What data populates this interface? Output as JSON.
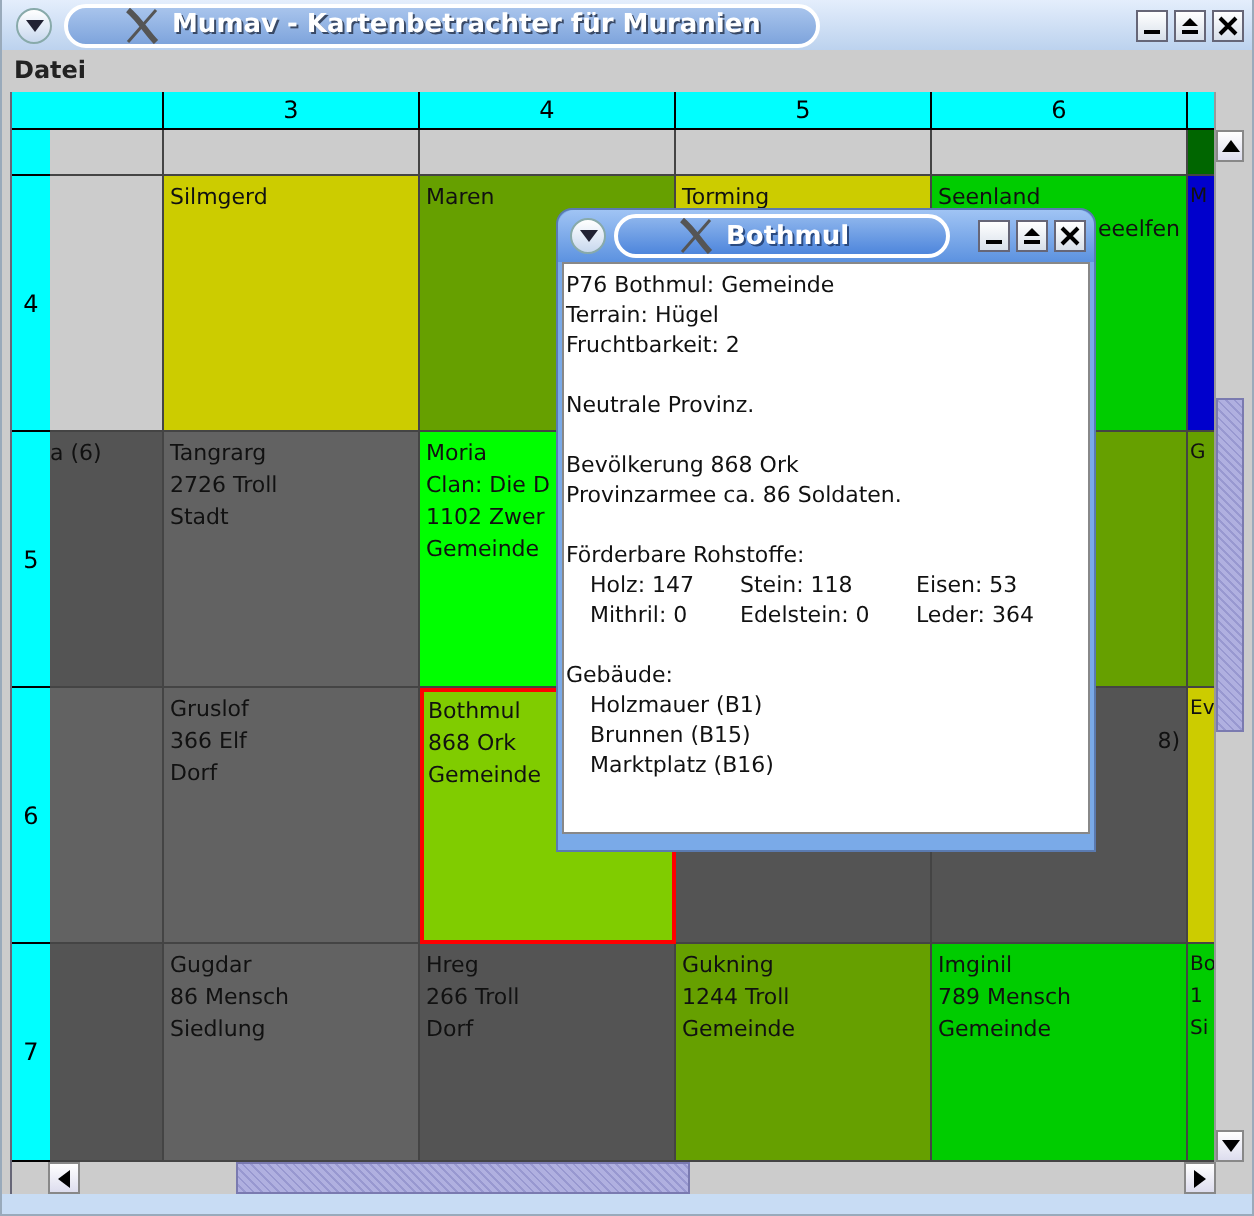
{
  "window": {
    "title": "Mumav - Kartenbetrachter für Muranien"
  },
  "menu": [
    "Datei"
  ],
  "map": {
    "columns": [
      "",
      "3",
      "4",
      "5",
      "6",
      ""
    ],
    "rows": [
      {
        "cells": [
          {
            "color": "#cccccc",
            "selected": false
          },
          {
            "color": "#cccccc",
            "selected": false
          },
          {
            "color": "#cccccc",
            "selected": false
          },
          {
            "color": "#cccccc",
            "selected": false
          },
          {
            "color": "#cccccc",
            "selected": false
          },
          {
            "color": "#006600",
            "selected": false
          }
        ]
      },
      {
        "label": "4",
        "cells": [
          {
            "color": "#cccccc",
            "selected": false
          },
          {
            "color": "#cccc00",
            "selected": false,
            "lines": [
              "Silmgerd"
            ]
          },
          {
            "color": "#66a000",
            "selected": false,
            "lines": [
              "Maren"
            ]
          },
          {
            "color": "#cccc00",
            "selected": false,
            "lines": [
              "Torming"
            ]
          },
          {
            "color": "#00cc00",
            "selected": false,
            "lines": [
              "Seenland",
              {
                "kind": "tail",
                "text": "eeelfen"
              }
            ]
          },
          {
            "color": "#0000cc",
            "selected": false,
            "lines": [
              "M"
            ]
          }
        ]
      },
      {
        "label": "5",
        "cells": [
          {
            "color": "#545454",
            "selected": false,
            "lines": [
              "a (6)"
            ]
          },
          {
            "color": "#626262",
            "selected": false,
            "lines": [
              "Tangrarg",
              "2726 Troll",
              "Stadt"
            ]
          },
          {
            "color": "#00ff00",
            "selected": false,
            "lines": [
              "Moria",
              "Clan: Die D",
              "1102 Zwer",
              "Gemeinde"
            ]
          },
          {},
          {
            "color": "#66a000",
            "selected": false
          },
          {
            "color": "#66a000",
            "selected": false,
            "lines": [
              "G"
            ]
          }
        ]
      },
      {
        "label": "6",
        "cells": [
          {
            "color": "#626262",
            "selected": false
          },
          {
            "color": "#626262",
            "selected": false,
            "lines": [
              "Gruslof",
              "366 Elf",
              "Dorf"
            ]
          },
          {
            "color": "#80cc00",
            "selected": true,
            "lines": [
              "Bothmul",
              "868 Ork",
              "Gemeinde"
            ]
          },
          {
            "color": "#545454",
            "selected": false
          },
          {
            "color": "#545454",
            "selected": false,
            "lines": [
              {
                "kind": "tail",
                "text": "8)"
              }
            ]
          },
          {
            "color": "#cccc00",
            "selected": false,
            "lines": [
              "Ev"
            ]
          }
        ]
      },
      {
        "label": "7",
        "cells": [
          {
            "color": "#545454",
            "selected": false
          },
          {
            "color": "#626262",
            "selected": false,
            "lines": [
              "Gugdar",
              "86 Mensch",
              "Siedlung"
            ]
          },
          {
            "color": "#545454",
            "selected": false,
            "lines": [
              "Hreg",
              "266 Troll",
              "Dorf"
            ]
          },
          {
            "color": "#66a000",
            "selected": false,
            "lines": [
              "Gukning",
              "1244 Troll",
              "Gemeinde"
            ]
          },
          {
            "color": "#00cc00",
            "selected": false,
            "lines": [
              "Imginil",
              "789 Mensch",
              "Gemeinde"
            ]
          },
          {
            "color": "#00cc00",
            "selected": false,
            "lines": [
              "Bo",
              "1",
              "Si"
            ]
          }
        ]
      }
    ]
  },
  "info_window": {
    "title": "Bothmul",
    "sections": [
      {
        "kind": "text",
        "lines": [
          "P76 Bothmul: Gemeinde",
          "Terrain: Hügel",
          "Fruchtbarkeit: 2"
        ]
      },
      {
        "kind": "text",
        "lines": [
          "Neutrale Provinz."
        ]
      },
      {
        "kind": "text",
        "lines": [
          "Bevölkerung 868 Ork",
          "Provinzarmee ca. 86 Soldaten."
        ]
      },
      {
        "kind": "table",
        "heading": "Förderbare Rohstoffe:",
        "rows": [
          [
            "Holz: 147",
            "Stein: 118",
            "Eisen: 53"
          ],
          [
            "Mithril: 0",
            "Edelstein: 0",
            "Leder: 364"
          ]
        ]
      },
      {
        "kind": "list",
        "heading": "Gebäude:",
        "items": [
          "Holzmauer (B1)",
          "Brunnen (B15)",
          "Marktplatz (B16)"
        ]
      }
    ]
  }
}
